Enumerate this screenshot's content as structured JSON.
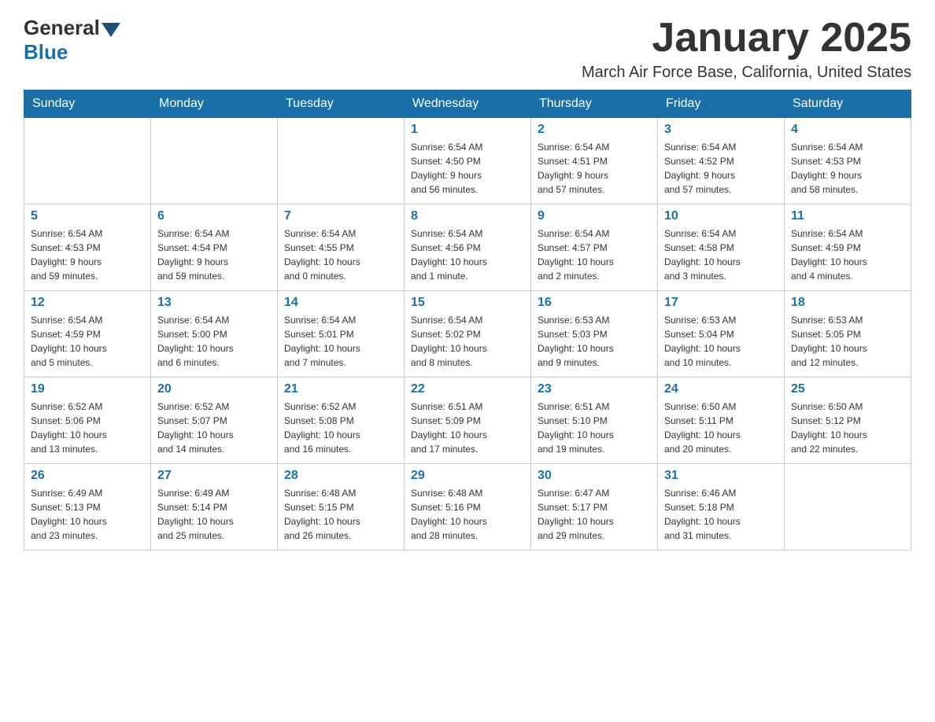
{
  "header": {
    "logo_general": "General",
    "logo_blue": "Blue",
    "title": "January 2025",
    "location": "March Air Force Base, California, United States"
  },
  "days_of_week": [
    "Sunday",
    "Monday",
    "Tuesday",
    "Wednesday",
    "Thursday",
    "Friday",
    "Saturday"
  ],
  "weeks": [
    [
      {
        "day": "",
        "info": ""
      },
      {
        "day": "",
        "info": ""
      },
      {
        "day": "",
        "info": ""
      },
      {
        "day": "1",
        "info": "Sunrise: 6:54 AM\nSunset: 4:50 PM\nDaylight: 9 hours\nand 56 minutes."
      },
      {
        "day": "2",
        "info": "Sunrise: 6:54 AM\nSunset: 4:51 PM\nDaylight: 9 hours\nand 57 minutes."
      },
      {
        "day": "3",
        "info": "Sunrise: 6:54 AM\nSunset: 4:52 PM\nDaylight: 9 hours\nand 57 minutes."
      },
      {
        "day": "4",
        "info": "Sunrise: 6:54 AM\nSunset: 4:53 PM\nDaylight: 9 hours\nand 58 minutes."
      }
    ],
    [
      {
        "day": "5",
        "info": "Sunrise: 6:54 AM\nSunset: 4:53 PM\nDaylight: 9 hours\nand 59 minutes."
      },
      {
        "day": "6",
        "info": "Sunrise: 6:54 AM\nSunset: 4:54 PM\nDaylight: 9 hours\nand 59 minutes."
      },
      {
        "day": "7",
        "info": "Sunrise: 6:54 AM\nSunset: 4:55 PM\nDaylight: 10 hours\nand 0 minutes."
      },
      {
        "day": "8",
        "info": "Sunrise: 6:54 AM\nSunset: 4:56 PM\nDaylight: 10 hours\nand 1 minute."
      },
      {
        "day": "9",
        "info": "Sunrise: 6:54 AM\nSunset: 4:57 PM\nDaylight: 10 hours\nand 2 minutes."
      },
      {
        "day": "10",
        "info": "Sunrise: 6:54 AM\nSunset: 4:58 PM\nDaylight: 10 hours\nand 3 minutes."
      },
      {
        "day": "11",
        "info": "Sunrise: 6:54 AM\nSunset: 4:59 PM\nDaylight: 10 hours\nand 4 minutes."
      }
    ],
    [
      {
        "day": "12",
        "info": "Sunrise: 6:54 AM\nSunset: 4:59 PM\nDaylight: 10 hours\nand 5 minutes."
      },
      {
        "day": "13",
        "info": "Sunrise: 6:54 AM\nSunset: 5:00 PM\nDaylight: 10 hours\nand 6 minutes."
      },
      {
        "day": "14",
        "info": "Sunrise: 6:54 AM\nSunset: 5:01 PM\nDaylight: 10 hours\nand 7 minutes."
      },
      {
        "day": "15",
        "info": "Sunrise: 6:54 AM\nSunset: 5:02 PM\nDaylight: 10 hours\nand 8 minutes."
      },
      {
        "day": "16",
        "info": "Sunrise: 6:53 AM\nSunset: 5:03 PM\nDaylight: 10 hours\nand 9 minutes."
      },
      {
        "day": "17",
        "info": "Sunrise: 6:53 AM\nSunset: 5:04 PM\nDaylight: 10 hours\nand 10 minutes."
      },
      {
        "day": "18",
        "info": "Sunrise: 6:53 AM\nSunset: 5:05 PM\nDaylight: 10 hours\nand 12 minutes."
      }
    ],
    [
      {
        "day": "19",
        "info": "Sunrise: 6:52 AM\nSunset: 5:06 PM\nDaylight: 10 hours\nand 13 minutes."
      },
      {
        "day": "20",
        "info": "Sunrise: 6:52 AM\nSunset: 5:07 PM\nDaylight: 10 hours\nand 14 minutes."
      },
      {
        "day": "21",
        "info": "Sunrise: 6:52 AM\nSunset: 5:08 PM\nDaylight: 10 hours\nand 16 minutes."
      },
      {
        "day": "22",
        "info": "Sunrise: 6:51 AM\nSunset: 5:09 PM\nDaylight: 10 hours\nand 17 minutes."
      },
      {
        "day": "23",
        "info": "Sunrise: 6:51 AM\nSunset: 5:10 PM\nDaylight: 10 hours\nand 19 minutes."
      },
      {
        "day": "24",
        "info": "Sunrise: 6:50 AM\nSunset: 5:11 PM\nDaylight: 10 hours\nand 20 minutes."
      },
      {
        "day": "25",
        "info": "Sunrise: 6:50 AM\nSunset: 5:12 PM\nDaylight: 10 hours\nand 22 minutes."
      }
    ],
    [
      {
        "day": "26",
        "info": "Sunrise: 6:49 AM\nSunset: 5:13 PM\nDaylight: 10 hours\nand 23 minutes."
      },
      {
        "day": "27",
        "info": "Sunrise: 6:49 AM\nSunset: 5:14 PM\nDaylight: 10 hours\nand 25 minutes."
      },
      {
        "day": "28",
        "info": "Sunrise: 6:48 AM\nSunset: 5:15 PM\nDaylight: 10 hours\nand 26 minutes."
      },
      {
        "day": "29",
        "info": "Sunrise: 6:48 AM\nSunset: 5:16 PM\nDaylight: 10 hours\nand 28 minutes."
      },
      {
        "day": "30",
        "info": "Sunrise: 6:47 AM\nSunset: 5:17 PM\nDaylight: 10 hours\nand 29 minutes."
      },
      {
        "day": "31",
        "info": "Sunrise: 6:46 AM\nSunset: 5:18 PM\nDaylight: 10 hours\nand 31 minutes."
      },
      {
        "day": "",
        "info": ""
      }
    ]
  ]
}
